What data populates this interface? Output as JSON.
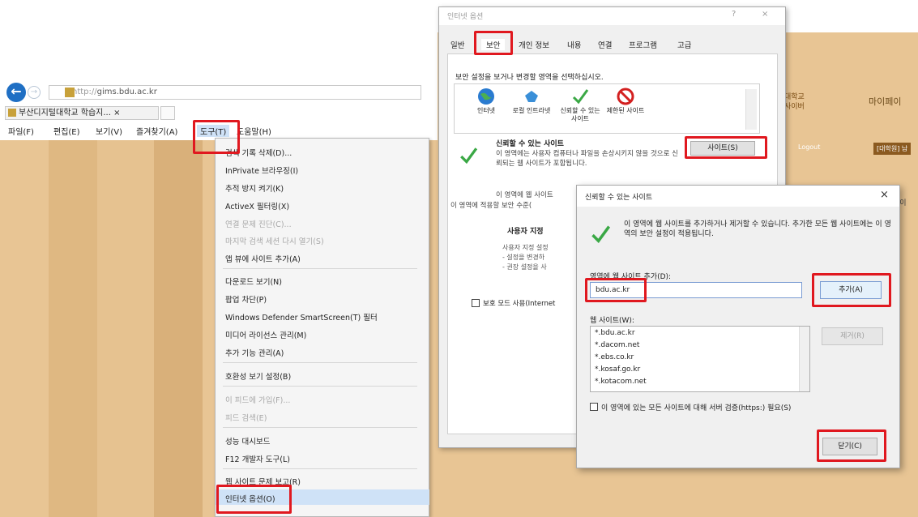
{
  "browser": {
    "address_prefix": "http://",
    "address": "gims.bdu.ac.kr",
    "tab_title": "부산디지털대학교 학습지...",
    "menu": [
      "파일(F)",
      "편집(E)",
      "보기(V)",
      "즐겨찾기(A)",
      "도구(T)",
      "도움말(H)"
    ]
  },
  "tools_menu": {
    "items": [
      {
        "label": "검색 기록 삭제(D)...",
        "disabled": false
      },
      {
        "label": "InPrivate 브라우징(I)",
        "disabled": false
      },
      {
        "label": "추적 방지 켜기(K)",
        "disabled": false
      },
      {
        "label": "ActiveX 필터링(X)",
        "disabled": false
      },
      {
        "label": "연결 문제 진단(C)...",
        "disabled": true
      },
      {
        "label": "마지막 검색 세션 다시 열기(S)",
        "disabled": true
      },
      {
        "label": "앱 뷰에 사이트 추가(A)",
        "disabled": false
      },
      {
        "label": "다운로드 보기(N)",
        "disabled": false
      },
      {
        "label": "팝업 차단(P)",
        "disabled": false
      },
      {
        "label": "Windows Defender SmartScreen(T) 필터",
        "disabled": false
      },
      {
        "label": "미디어 라이선스 관리(M)",
        "disabled": false
      },
      {
        "label": "추가 기능 관리(A)",
        "disabled": false
      },
      {
        "label": "호환성 보기 설정(B)",
        "disabled": false
      },
      {
        "label": "이 피드에 가입(F)...",
        "disabled": true
      },
      {
        "label": "피드 검색(E)",
        "disabled": true
      },
      {
        "label": "성능 대시보드",
        "disabled": false
      },
      {
        "label": "F12 개발자 도구(L)",
        "disabled": false
      },
      {
        "label": "웹 사이트 문제 보고(R)",
        "disabled": false
      },
      {
        "label": "인터넷 옵션(O)",
        "disabled": false
      }
    ]
  },
  "internet_options": {
    "title": "인터넷 옵션",
    "tabs": [
      "일반",
      "보안",
      "개인 정보",
      "내용",
      "연결",
      "프로그램",
      "고급"
    ],
    "instruction": "보안 설정을 보거나 변경할 영역을 선택하십시오.",
    "zones": [
      {
        "label": "인터넷",
        "icon": "globe-icon"
      },
      {
        "label": "로컬 인트라넷",
        "icon": "intranet-icon"
      },
      {
        "label": "신뢰할 수 있는 사이트",
        "icon": "checkmark-icon"
      },
      {
        "label": "제한된 사이트",
        "icon": "restricted-icon"
      }
    ],
    "selected_zone_title": "신뢰할 수 있는 사이트",
    "selected_zone_desc": "이 영역에는 사용자 컴퓨터나 파일을 손상시키지 않을 것으로 신뢰되는 웹 사이트가 포함됩니다.",
    "sites_button": "사이트(S)",
    "level_text_1": "이 영역에 웹 사이트",
    "level_text_2": "이 영역에 적용할 보안 수준(",
    "custom_title": "사용자 지정",
    "custom_lines": [
      "사용자 지정 설정",
      "- 설정을 변경하",
      "- 권장 설정을 사"
    ],
    "protected_mode": "보호 모드 사용(Internet"
  },
  "trusted_sites": {
    "title": "신뢰할 수 있는 사이트",
    "description": "이 영역에 웹 사이트를 추가하거나 제거할 수 있습니다. 추가한 모든 웹 사이트에는 이 영역의 보안 설정이 적용됩니다.",
    "add_label": "영역에 웹 사이트 추가(D):",
    "add_value": "bdu.ac.kr",
    "add_button": "추가(A)",
    "list_label": "웹 사이트(W):",
    "sites": [
      "*.bdu.ac.kr",
      "*.dacom.net",
      "*.ebs.co.kr",
      "*.kosaf.go.kr",
      "*.kotacom.net"
    ],
    "remove_button": "제거(R)",
    "https_label": "이 영역에 있는 모든 사이트에 대해 서버 검증(https:) 필요(S)",
    "close_button": "닫기(C)"
  },
  "background_site": {
    "logo_line1": "대학교",
    "logo_line2": "사이버",
    "mypage": "마이페이",
    "logout": "Logout",
    "badge": "[대학원] 남",
    "side": "마이"
  }
}
